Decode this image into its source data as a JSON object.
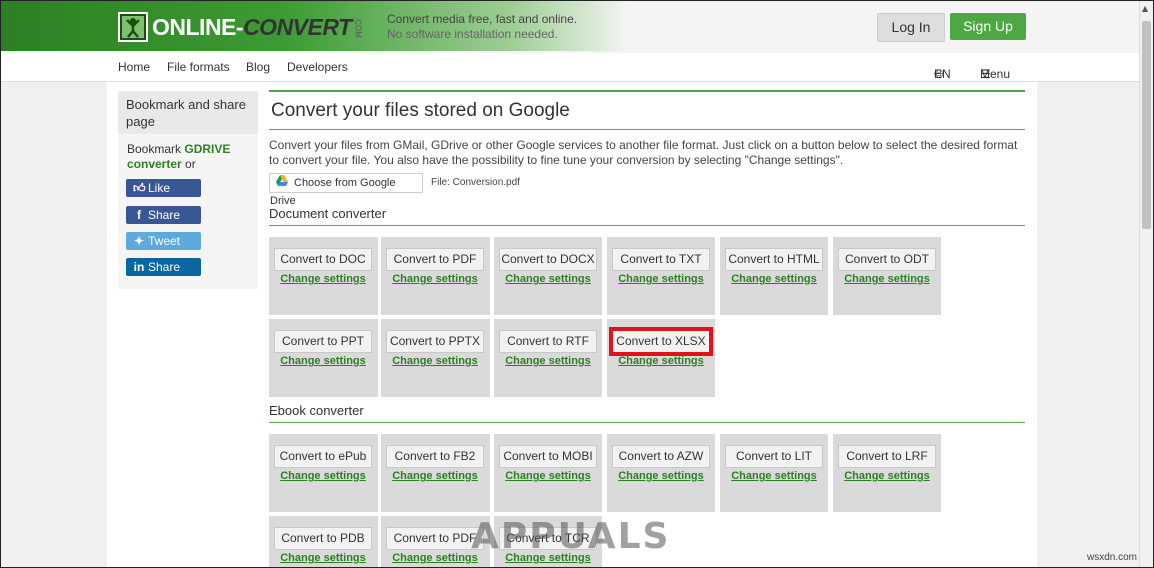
{
  "header": {
    "logo_main": "ONLINE-",
    "logo_second": "CONVERT",
    "logo_com": ".COM",
    "tagline_line1": "Convert media free, fast and online.",
    "tagline_line2": "No software installation needed.",
    "login_label": "Log In",
    "signup_label": "Sign Up"
  },
  "nav": {
    "items": [
      {
        "label": "Home"
      },
      {
        "label": "File formats"
      },
      {
        "label": "Blog"
      },
      {
        "label": "Developers"
      }
    ],
    "language": "EN",
    "menu_label": "Menu"
  },
  "sidebar": {
    "title": "Bookmark and share page",
    "bookmark_prefix": "Bookmark ",
    "bookmark_link": "GDRIVE converter",
    "bookmark_suffix": " or",
    "social": [
      {
        "label": "Like",
        "icon": "thumbs-up-icon"
      },
      {
        "label": "Share",
        "icon": "facebook-icon"
      },
      {
        "label": "Tweet",
        "icon": "twitter-icon"
      },
      {
        "label": "Share",
        "icon": "linkedin-icon"
      }
    ]
  },
  "main": {
    "title": "Convert your files stored on Google",
    "description": "Convert your files from GMail, GDrive or other Google services to another file format. Just click on a button below to select the desired format to convert your file. You also have the possibility to fine tune your conversion by selecting \"Change settings\".",
    "gdrive_button": "Choose from Google Drive",
    "file_label": "File: Conversion.pdf",
    "change_settings_label": "Change settings",
    "sections": [
      {
        "title": "Document converter",
        "items": [
          "Convert to DOC",
          "Convert to PDF",
          "Convert to DOCX",
          "Convert to TXT",
          "Convert to HTML",
          "Convert to ODT",
          "Convert to PPT",
          "Convert to PPTX",
          "Convert to RTF",
          "Convert to XLSX"
        ],
        "highlighted_index": 9
      },
      {
        "title": "Ebook converter",
        "items": [
          "Convert to ePub",
          "Convert to FB2",
          "Convert to MOBI",
          "Convert to AZW",
          "Convert to LIT",
          "Convert to LRF",
          "Convert to PDB",
          "Convert to PDF",
          "Convert to TCR"
        ]
      }
    ]
  },
  "watermark": {
    "text": "APPUALS",
    "credit": "wsxdn.com"
  },
  "colors": {
    "brand_green": "#4da843",
    "link_green": "#2d7f24",
    "highlight_red": "#e0121a"
  }
}
